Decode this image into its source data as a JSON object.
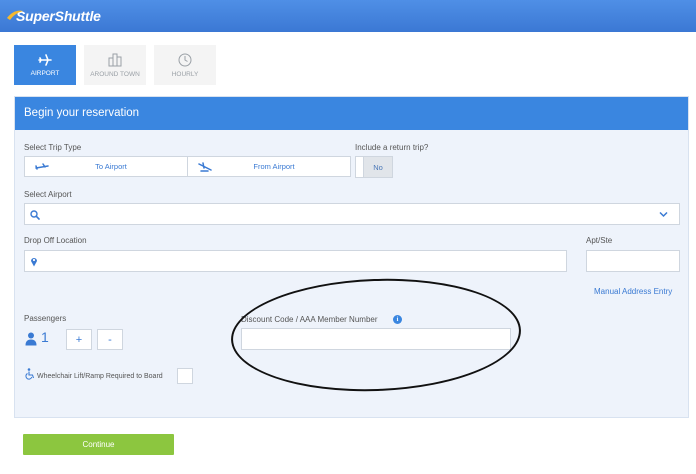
{
  "app": {
    "logo_text": "SuperShuttle"
  },
  "tabs": [
    {
      "label": "AIRPORT",
      "icon": "plane-icon",
      "active": true
    },
    {
      "label": "AROUND TOWN",
      "icon": "buildings-icon",
      "active": false
    },
    {
      "label": "HOURLY",
      "icon": "clock-icon",
      "active": false
    }
  ],
  "form": {
    "title": "Begin your reservation",
    "trip_type_label": "Select Trip Type",
    "to_airport": "To Airport",
    "from_airport": "From Airport",
    "return_trip_label": "Include a return trip?",
    "return_trip_value": "No",
    "select_airport_label": "Select Airport",
    "select_airport_value": "",
    "dropoff_label": "Drop Off Location",
    "dropoff_value": "",
    "apt_label": "Apt/Ste",
    "apt_value": "",
    "manual_address": "Manual Address Entry",
    "passengers_label": "Passengers",
    "passengers_count": "1",
    "plus": "+",
    "minus": "-",
    "discount_label": "Discount Code / AAA Member Number",
    "discount_value": "",
    "info": "i",
    "wheelchair_label": "Wheelchair Lift/Ramp Required to Board",
    "continue": "Continue"
  },
  "colors": {
    "brand_blue": "#3a86e0",
    "link_blue": "#3a7ad3",
    "continue_green": "#8cc63f",
    "panel_bg": "#eef3fb"
  }
}
